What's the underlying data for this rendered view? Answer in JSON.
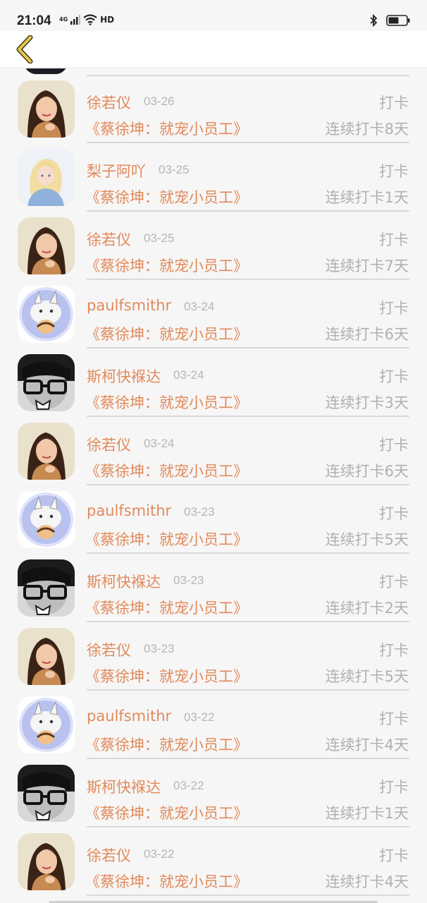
{
  "status_bar": {
    "time": "21:04",
    "network": "4G",
    "wifi_label": "HD",
    "icons": [
      "signal-icon",
      "wifi-icon",
      "bluetooth-icon",
      "battery-icon"
    ]
  },
  "nav": {
    "back_icon": "chevron-left-icon",
    "back_color": "#e8c84a"
  },
  "colors": {
    "accent": "#e08a5a",
    "muted": "#b0b0b0",
    "divider": "#d9d9d9"
  },
  "rows": [
    {
      "name": "徐若仪",
      "date": "03-26",
      "action": "打卡",
      "book": "《蔡徐坤：就宠小员工》",
      "streak": "连续打卡8天",
      "avatar": "avatar-girl"
    },
    {
      "name": "梨子阿吖",
      "date": "03-25",
      "action": "打卡",
      "book": "《蔡徐坤：就宠小员工》",
      "streak": "连续打卡1天",
      "avatar": "avatar-princess"
    },
    {
      "name": "徐若仪",
      "date": "03-25",
      "action": "打卡",
      "book": "《蔡徐坤：就宠小员工》",
      "streak": "连续打卡7天",
      "avatar": "avatar-girl"
    },
    {
      "name": "paulfsmithr",
      "date": "03-24",
      "action": "打卡",
      "book": "《蔡徐坤：就宠小员工》",
      "streak": "连续打卡6天",
      "avatar": "avatar-cartoon"
    },
    {
      "name": "斯柯快褓达",
      "date": "03-24",
      "action": "打卡",
      "book": "《蔡徐坤：就宠小员工》",
      "streak": "连续打卡3天",
      "avatar": "avatar-glasses"
    },
    {
      "name": "徐若仪",
      "date": "03-24",
      "action": "打卡",
      "book": "《蔡徐坤：就宠小员工》",
      "streak": "连续打卡6天",
      "avatar": "avatar-girl"
    },
    {
      "name": "paulfsmithr",
      "date": "03-23",
      "action": "打卡",
      "book": "《蔡徐坤：就宠小员工》",
      "streak": "连续打卡5天",
      "avatar": "avatar-cartoon"
    },
    {
      "name": "斯柯快褓达",
      "date": "03-23",
      "action": "打卡",
      "book": "《蔡徐坤：就宠小员工》",
      "streak": "连续打卡2天",
      "avatar": "avatar-glasses"
    },
    {
      "name": "徐若仪",
      "date": "03-23",
      "action": "打卡",
      "book": "《蔡徐坤：就宠小员工》",
      "streak": "连续打卡5天",
      "avatar": "avatar-girl"
    },
    {
      "name": "paulfsmithr",
      "date": "03-22",
      "action": "打卡",
      "book": "《蔡徐坤：就宠小员工》",
      "streak": "连续打卡4天",
      "avatar": "avatar-cartoon"
    },
    {
      "name": "斯柯快褓达",
      "date": "03-22",
      "action": "打卡",
      "book": "《蔡徐坤：就宠小员工》",
      "streak": "连续打卡1天",
      "avatar": "avatar-glasses"
    },
    {
      "name": "徐若仪",
      "date": "03-22",
      "action": "打卡",
      "book": "《蔡徐坤：就宠小员工》",
      "streak": "连续打卡4天",
      "avatar": "avatar-girl"
    }
  ]
}
